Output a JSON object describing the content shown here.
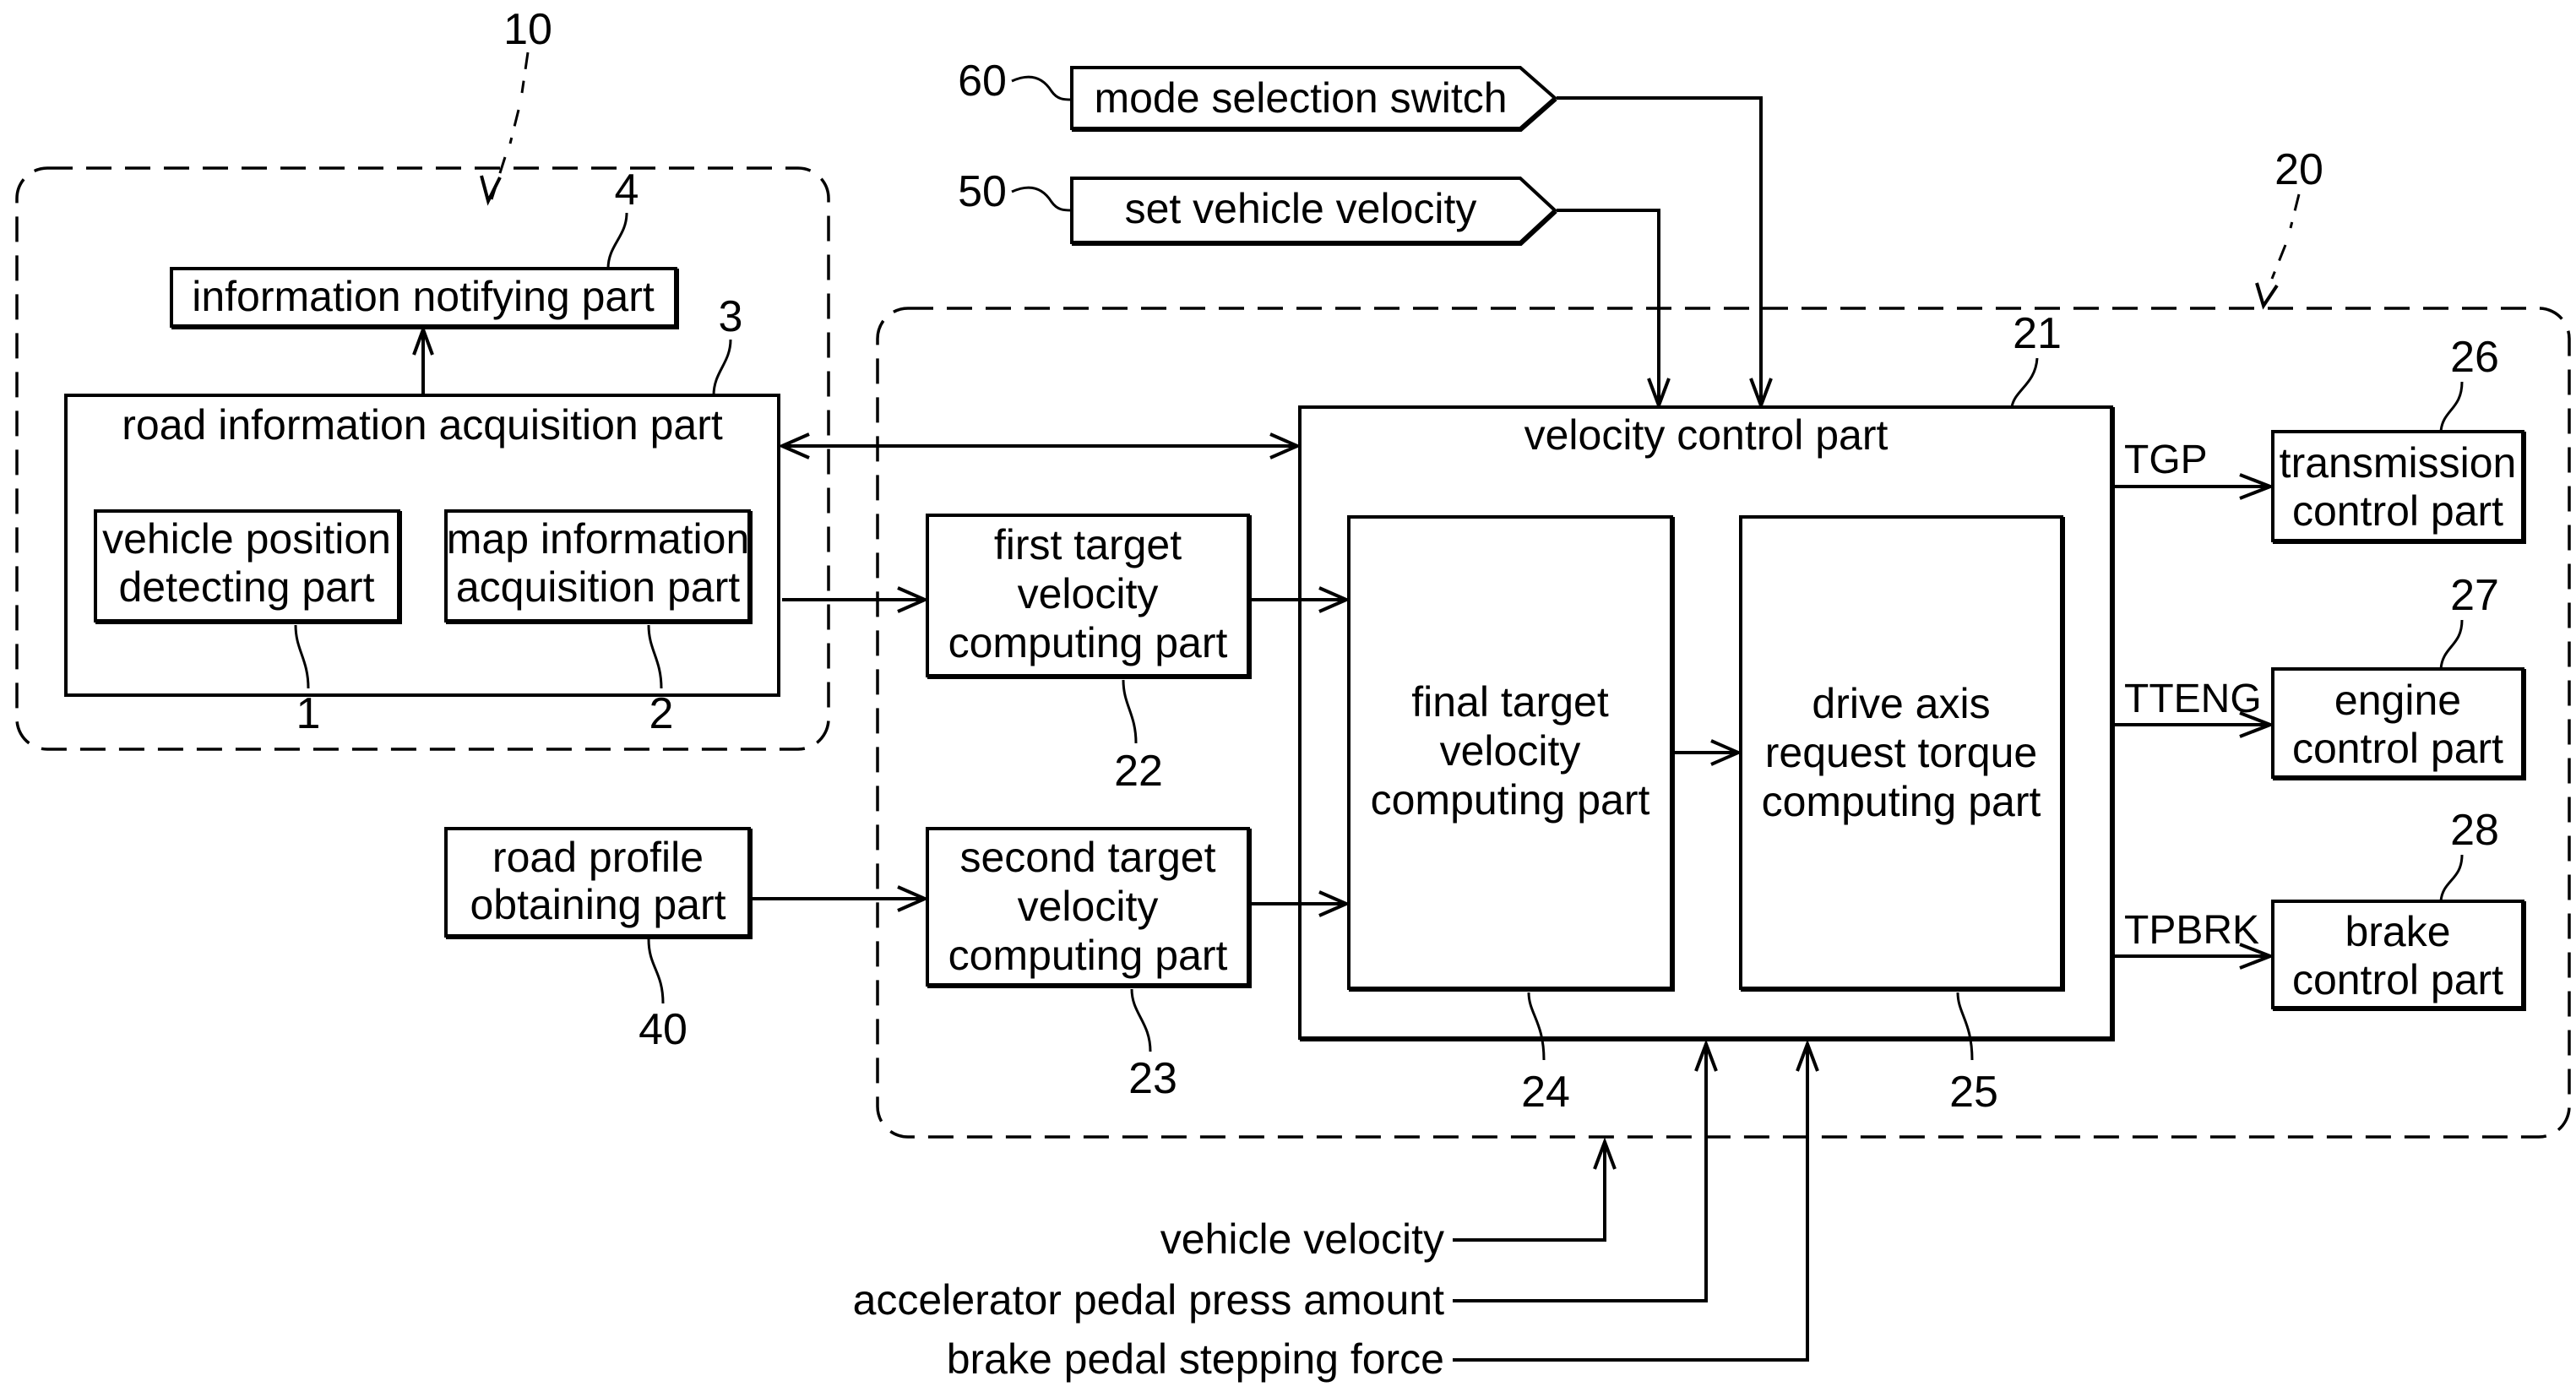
{
  "groups": {
    "g10": {
      "ref": "10"
    },
    "g20": {
      "ref": "20"
    }
  },
  "blocks": {
    "info_notify": {
      "ref": "4",
      "lines": [
        "information notifying part"
      ]
    },
    "road_info": {
      "ref": "3",
      "lines": [
        "road information acquisition part"
      ]
    },
    "vehicle_pos": {
      "ref": "1",
      "lines": [
        "vehicle position",
        "detecting part"
      ]
    },
    "map_info": {
      "ref": "2",
      "lines": [
        "map information",
        "acquisition part"
      ]
    },
    "first_target": {
      "ref": "22",
      "lines": [
        "first target",
        "velocity",
        "computing part"
      ]
    },
    "second_target": {
      "ref": "23",
      "lines": [
        "second target",
        "velocity",
        "computing part"
      ]
    },
    "road_profile": {
      "ref": "40",
      "lines": [
        "road profile",
        "obtaining part"
      ]
    },
    "velocity_control": {
      "ref": "21",
      "lines": [
        "velocity control part"
      ]
    },
    "final_target": {
      "ref": "24",
      "lines": [
        "final target",
        "velocity",
        "computing part"
      ]
    },
    "drive_axis": {
      "ref": "25",
      "lines": [
        "drive axis",
        "request torque",
        "computing part"
      ]
    },
    "transmission": {
      "ref": "26",
      "lines": [
        "transmission",
        "control part"
      ]
    },
    "engine": {
      "ref": "27",
      "lines": [
        "engine",
        "control part"
      ]
    },
    "brake": {
      "ref": "28",
      "lines": [
        "brake",
        "control part"
      ]
    },
    "mode_switch": {
      "ref": "60",
      "lines": [
        "mode selection switch"
      ]
    },
    "set_velocity": {
      "ref": "50",
      "lines": [
        "set vehicle velocity"
      ]
    }
  },
  "signals": {
    "tgp": "TGP",
    "tteng": "TTENG",
    "tpbrk": "TPBRK"
  },
  "inputs": {
    "vehicle_velocity": "vehicle velocity",
    "accelerator": "accelerator pedal press amount",
    "brake_force": "brake pedal stepping force"
  }
}
